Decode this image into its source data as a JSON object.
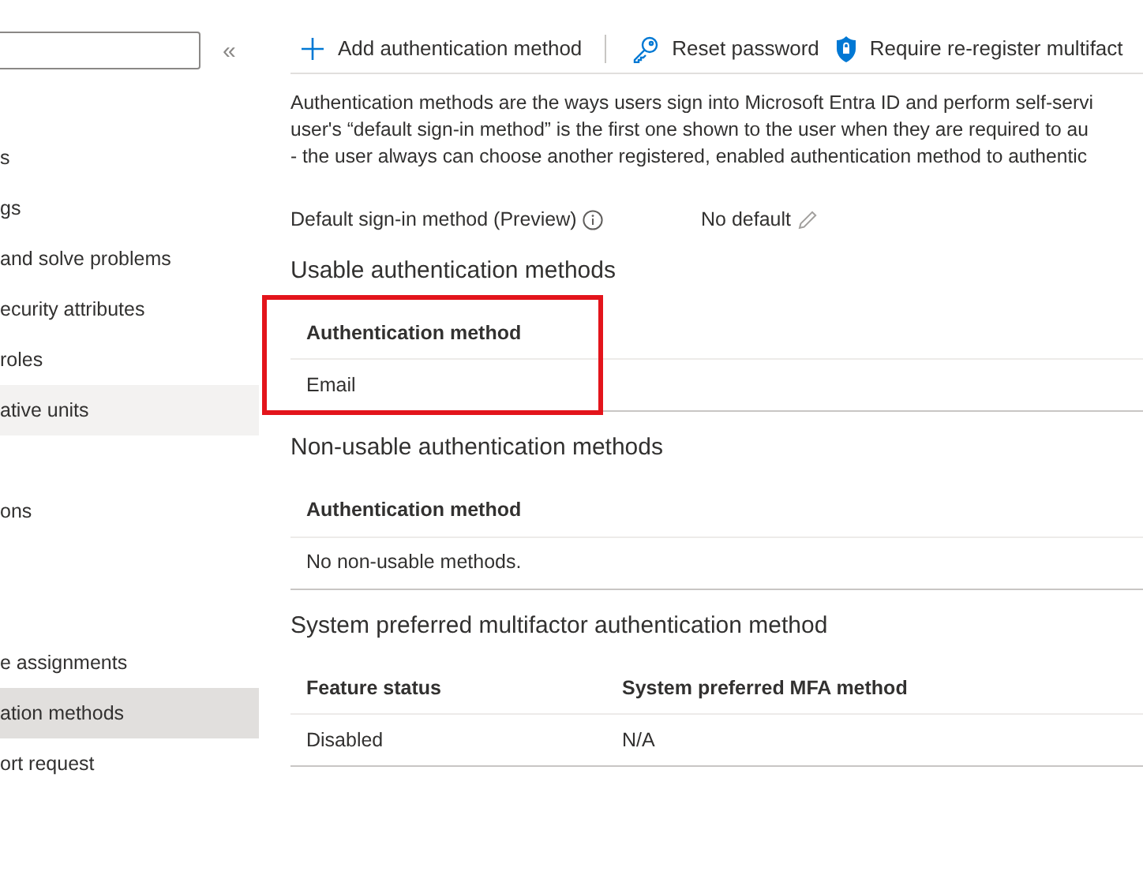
{
  "sidebar": {
    "collapse_label": "«",
    "items": [
      {
        "kind": "item",
        "label": "s",
        "selected": false,
        "hovered": false
      },
      {
        "kind": "item",
        "label": "gs",
        "selected": false,
        "hovered": false
      },
      {
        "kind": "item",
        "label": "and solve problems",
        "selected": false,
        "hovered": false
      },
      {
        "kind": "item",
        "label": "ecurity attributes",
        "selected": false,
        "hovered": false
      },
      {
        "kind": "item",
        "label": "roles",
        "selected": false,
        "hovered": false
      },
      {
        "kind": "item",
        "label": "ative units",
        "selected": false,
        "hovered": true
      },
      {
        "kind": "blank"
      },
      {
        "kind": "item",
        "label": "ons",
        "selected": false,
        "hovered": false
      },
      {
        "kind": "blank"
      },
      {
        "kind": "blank"
      },
      {
        "kind": "item",
        "label": "e assignments",
        "selected": false,
        "hovered": false
      },
      {
        "kind": "item",
        "label": "ation methods",
        "selected": true,
        "hovered": false
      },
      {
        "kind": "item",
        "label": "ort request",
        "selected": false,
        "hovered": false
      }
    ]
  },
  "toolbar": [
    {
      "kind": "plus",
      "label": "Add authentication method"
    },
    {
      "kind": "key",
      "label": "Reset password"
    },
    {
      "kind": "shield",
      "label": "Require re-register multifact"
    }
  ],
  "description": [
    "Authentication methods are the ways users sign into Microsoft Entra ID and perform self-servi",
    "user's “default sign-in method” is the first one shown to the user when they are required to au",
    "- the user always can choose another registered, enabled authentication method to authentic"
  ],
  "default_method": {
    "label": "Default sign-in method (Preview)",
    "value": "No default"
  },
  "sections": [
    {
      "title": "Usable authentication methods",
      "highlighted": true,
      "columns": [
        "Authentication method"
      ],
      "rows": [
        [
          "Email"
        ]
      ]
    },
    {
      "title": "Non-usable authentication methods",
      "columns": [
        "Authentication method"
      ],
      "rows": [
        [
          "No non-usable methods."
        ]
      ]
    },
    {
      "title": "System preferred multifactor authentication method",
      "columns": [
        "Feature status",
        "System preferred MFA method"
      ],
      "rows": [
        [
          "Disabled",
          "N/A"
        ]
      ]
    }
  ]
}
